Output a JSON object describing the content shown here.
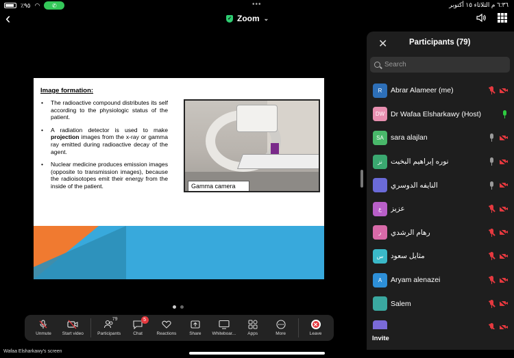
{
  "status_bar": {
    "battery": "٪٩٥",
    "datetime": "٦:٣٦ م   الثلاثاء ١٥ أكتوبر"
  },
  "header": {
    "app_title": "Zoom"
  },
  "slide": {
    "heading": "Image formation:",
    "bullets": [
      "The radioactive compound distributes its self according to the physiologic status of the patient.",
      "A radiation detector is used to make projection images from the x-ray or gamma ray emitted during radioactive decay of the agent.",
      "Nuclear medicine produces emission images (opposite to transmission images), because the radioisotopes emit their energy from the inside of the patient."
    ],
    "bullet_bold_word": "projection",
    "photo_caption": "Gamma camera"
  },
  "toolbar": {
    "unmute": "Unmute",
    "start_video": "Start video",
    "participants": "Participants",
    "participants_count": "79",
    "chat": "Chat",
    "chat_badge": "5",
    "reactions": "Reactions",
    "share": "Share",
    "whiteboard": "Whiteboar...",
    "apps": "Apps",
    "more": "More",
    "leave": "Leave"
  },
  "screen_label": "Wafaa Elsharkawy's screen",
  "panel": {
    "title": "Participants (79)",
    "search_placeholder": "Search",
    "invite": "Invite",
    "participants": [
      {
        "initials": "R",
        "name": "Abrar Alameer (me)",
        "color": "#2d6fb8",
        "mic": "muted",
        "cam": true
      },
      {
        "initials": "DW",
        "name": "Dr Wafaa Elsharkawy (Host)",
        "color": "#e88fb0",
        "mic": "active",
        "cam": false
      },
      {
        "initials": "SA",
        "name": "sara alajlan",
        "color": "#49b86a",
        "mic": "gray",
        "cam": true
      },
      {
        "initials": "نز",
        "name": "نوره إبراهيم البخيت",
        "color": "#3aa870",
        "mic": "gray",
        "cam": true
      },
      {
        "initials": "",
        "name": "النايفه الدوسري",
        "color": "#6a6ad8",
        "mic": "gray",
        "cam": true
      },
      {
        "initials": "ع",
        "name": "عزيز",
        "color": "#b85fc8",
        "mic": "muted",
        "cam": true
      },
      {
        "initials": "ر",
        "name": "رهام الرشدي",
        "color": "#d86aa8",
        "mic": "muted",
        "cam": true
      },
      {
        "initials": "س",
        "name": "مثايل سعود",
        "color": "#3ab8c8",
        "mic": "muted",
        "cam": true
      },
      {
        "initials": "A",
        "name": "Aryam alenazei",
        "color": "#2d8fd8",
        "mic": "muted",
        "cam": true
      },
      {
        "initials": "",
        "name": "Salem",
        "color": "#3aa8a0",
        "mic": "muted",
        "cam": true
      },
      {
        "initials": "",
        "name": "",
        "color": "#7a6ad8",
        "mic": "muted",
        "cam": true
      }
    ]
  }
}
